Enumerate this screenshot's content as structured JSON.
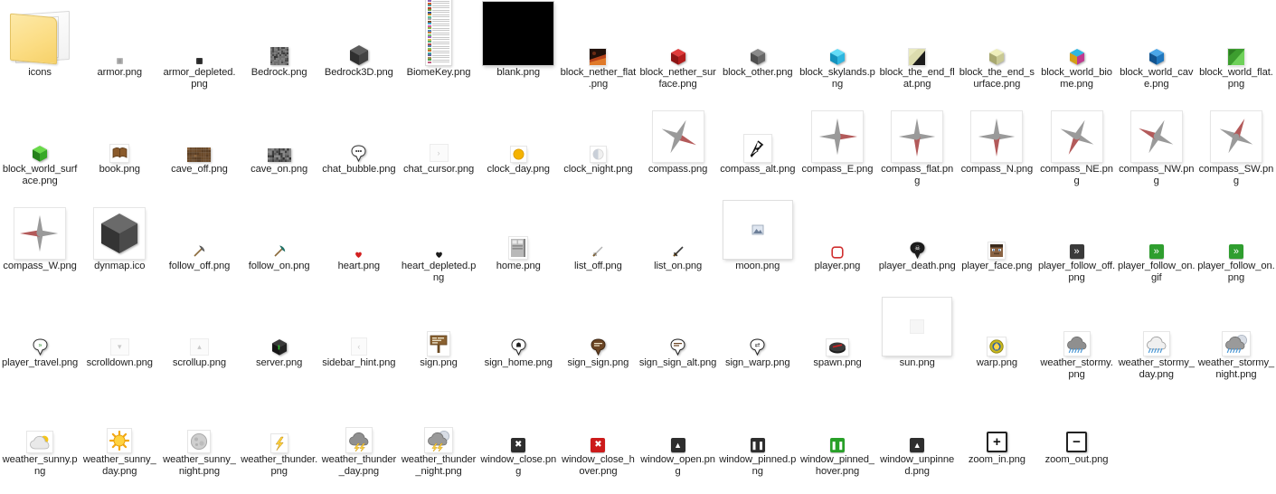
{
  "window": {
    "title": "icons",
    "view": "medium-icons-grid",
    "columns": 16,
    "rows": 5,
    "background_color": "#ffffff",
    "label_color": "#1f1f1f"
  },
  "items": [
    {
      "name": "icons",
      "icon": "folder-icon",
      "type": "folder"
    },
    {
      "name": "armor.png",
      "icon": "armor-chestplate-icon",
      "type": "png"
    },
    {
      "name": "armor_depleted.png",
      "icon": "armor-depleted-icon",
      "type": "png"
    },
    {
      "name": "Bedrock.png",
      "icon": "bedrock-texture-icon",
      "type": "png"
    },
    {
      "name": "Bedrock3D.png",
      "icon": "bedrock-cube-icon",
      "type": "png"
    },
    {
      "name": "BiomeKey.png",
      "icon": "biome-key-legend-icon",
      "type": "png"
    },
    {
      "name": "blank.png",
      "icon": "blank-black-square-icon",
      "type": "png"
    },
    {
      "name": "block_nether_flat.png",
      "icon": "nether-flat-tile-icon",
      "type": "png"
    },
    {
      "name": "block_nether_surface.png",
      "icon": "red-cube-icon",
      "type": "png"
    },
    {
      "name": "block_other.png",
      "icon": "gray-cube-icon",
      "type": "png"
    },
    {
      "name": "block_skylands.png",
      "icon": "cyan-cube-icon",
      "type": "png"
    },
    {
      "name": "block_the_end_flat.png",
      "icon": "end-flat-tile-icon",
      "type": "png"
    },
    {
      "name": "block_the_end_surface.png",
      "icon": "pale-yellow-cube-icon",
      "type": "png"
    },
    {
      "name": "block_world_biome.png",
      "icon": "biome-cube-icon",
      "type": "png"
    },
    {
      "name": "block_world_cave.png",
      "icon": "blue-cube-icon",
      "type": "png"
    },
    {
      "name": "block_world_flat.png",
      "icon": "world-flat-tile-icon",
      "type": "png"
    },
    {
      "name": "block_world_surface.png",
      "icon": "green-cube-icon",
      "type": "png"
    },
    {
      "name": "book.png",
      "icon": "book-icon",
      "type": "png"
    },
    {
      "name": "cave_off.png",
      "icon": "grass-block-texture-icon",
      "type": "png"
    },
    {
      "name": "cave_on.png",
      "icon": "stone-texture-icon",
      "type": "png"
    },
    {
      "name": "chat_bubble.png",
      "icon": "chat-bubble-icon",
      "type": "png"
    },
    {
      "name": "chat_cursor.png",
      "icon": "chat-cursor-icon",
      "type": "png"
    },
    {
      "name": "clock_day.png",
      "icon": "clock-day-sun-icon",
      "type": "png"
    },
    {
      "name": "clock_night.png",
      "icon": "clock-night-moon-icon",
      "type": "png"
    },
    {
      "name": "compass.png",
      "icon": "compass-rose-icon",
      "type": "png"
    },
    {
      "name": "compass_alt.png",
      "icon": "compass-arrow-icon",
      "type": "png"
    },
    {
      "name": "compass_E.png",
      "icon": "compass-east-icon",
      "type": "png"
    },
    {
      "name": "compass_flat.png",
      "icon": "compass-flat-icon",
      "type": "png"
    },
    {
      "name": "compass_N.png",
      "icon": "compass-north-icon",
      "type": "png"
    },
    {
      "name": "compass_NE.png",
      "icon": "compass-northeast-icon",
      "type": "png"
    },
    {
      "name": "compass_NW.png",
      "icon": "compass-northwest-icon",
      "type": "png"
    },
    {
      "name": "compass_SW.png",
      "icon": "compass-southwest-icon",
      "type": "png"
    },
    {
      "name": "compass_W.png",
      "icon": "compass-west-icon",
      "type": "png"
    },
    {
      "name": "dynmap.ico",
      "icon": "dynmap-cube-icon",
      "type": "ico"
    },
    {
      "name": "follow_off.png",
      "icon": "follow-off-pickaxe-icon",
      "type": "png"
    },
    {
      "name": "follow_on.png",
      "icon": "follow-on-pickaxe-icon",
      "type": "png"
    },
    {
      "name": "heart.png",
      "icon": "heart-icon",
      "type": "png"
    },
    {
      "name": "heart_depleted.png",
      "icon": "heart-depleted-icon",
      "type": "png"
    },
    {
      "name": "home.png",
      "icon": "home-door-icon",
      "type": "png"
    },
    {
      "name": "list_off.png",
      "icon": "list-off-sword-icon",
      "type": "png"
    },
    {
      "name": "list_on.png",
      "icon": "list-on-sword-icon",
      "type": "png"
    },
    {
      "name": "moon.png",
      "icon": "moon-icon",
      "type": "png"
    },
    {
      "name": "player.png",
      "icon": "player-marker-icon",
      "type": "png"
    },
    {
      "name": "player_death.png",
      "icon": "player-death-skull-icon",
      "type": "png"
    },
    {
      "name": "player_face.png",
      "icon": "player-face-icon",
      "type": "png"
    },
    {
      "name": "player_follow_off.png",
      "icon": "player-follow-off-icon",
      "type": "png"
    },
    {
      "name": "player_follow_on.gif",
      "icon": "player-follow-on-icon",
      "type": "gif"
    },
    {
      "name": "player_follow_on.png",
      "icon": "player-follow-on-icon",
      "type": "png"
    },
    {
      "name": "player_travel.png",
      "icon": "player-travel-bubble-icon",
      "type": "png"
    },
    {
      "name": "scrolldown.png",
      "icon": "scroll-down-chevron-icon",
      "type": "png"
    },
    {
      "name": "scrollup.png",
      "icon": "scroll-up-chevron-icon",
      "type": "png"
    },
    {
      "name": "server.png",
      "icon": "server-cube-icon",
      "type": "png"
    },
    {
      "name": "sidebar_hint.png",
      "icon": "sidebar-hint-chevron-icon",
      "type": "png"
    },
    {
      "name": "sign.png",
      "icon": "sign-post-icon",
      "type": "png"
    },
    {
      "name": "sign_home.png",
      "icon": "sign-home-bubble-icon",
      "type": "png"
    },
    {
      "name": "sign_sign.png",
      "icon": "sign-sign-bubble-icon",
      "type": "png"
    },
    {
      "name": "sign_sign_alt.png",
      "icon": "sign-sign-alt-bubble-icon",
      "type": "png"
    },
    {
      "name": "sign_warp.png",
      "icon": "sign-warp-bubble-icon",
      "type": "png"
    },
    {
      "name": "spawn.png",
      "icon": "spawn-bed-icon",
      "type": "png"
    },
    {
      "name": "sun.png",
      "icon": "sun-icon",
      "type": "png"
    },
    {
      "name": "warp.png",
      "icon": "warp-portal-icon",
      "type": "png"
    },
    {
      "name": "weather_stormy.png",
      "icon": "weather-stormy-icon",
      "type": "png"
    },
    {
      "name": "weather_stormy_day.png",
      "icon": "weather-stormy-day-icon",
      "type": "png"
    },
    {
      "name": "weather_stormy_night.png",
      "icon": "weather-stormy-night-icon",
      "type": "png"
    },
    {
      "name": "weather_sunny.png",
      "icon": "weather-sunny-icon",
      "type": "png"
    },
    {
      "name": "weather_sunny_day.png",
      "icon": "weather-sunny-day-icon",
      "type": "png"
    },
    {
      "name": "weather_sunny_night.png",
      "icon": "weather-sunny-night-icon",
      "type": "png"
    },
    {
      "name": "weather_thunder.png",
      "icon": "weather-thunder-bolt-icon",
      "type": "png"
    },
    {
      "name": "weather_thunder_day.png",
      "icon": "weather-thunder-day-icon",
      "type": "png"
    },
    {
      "name": "weather_thunder_night.png",
      "icon": "weather-thunder-night-icon",
      "type": "png"
    },
    {
      "name": "window_close.png",
      "icon": "window-close-icon",
      "type": "png"
    },
    {
      "name": "window_close_hover.png",
      "icon": "window-close-hover-icon",
      "type": "png"
    },
    {
      "name": "window_open.png",
      "icon": "window-open-caret-icon",
      "type": "png"
    },
    {
      "name": "window_pinned.png",
      "icon": "window-pinned-icon",
      "type": "png"
    },
    {
      "name": "window_pinned_hover.png",
      "icon": "window-pinned-hover-icon",
      "type": "png"
    },
    {
      "name": "window_unpinned.png",
      "icon": "window-unpinned-caret-icon",
      "type": "png"
    },
    {
      "name": "zoom_in.png",
      "icon": "zoom-in-plus-icon",
      "type": "png"
    },
    {
      "name": "zoom_out.png",
      "icon": "zoom-out-minus-icon",
      "type": "png"
    }
  ],
  "colors": {
    "folder_yellow": "#fbdc82",
    "compass_red": "#b35a5a",
    "compass_gray": "#9a9a9a",
    "nether_red": "#c42020",
    "skylands_cyan": "#2ec3ef",
    "world_green": "#49b02f",
    "cave_blue": "#2b78c8",
    "end_yellow": "#d8d8a0",
    "close_red": "#cc1b1b",
    "pinned_green": "#28a028",
    "button_dark": "#2e2e2e"
  }
}
